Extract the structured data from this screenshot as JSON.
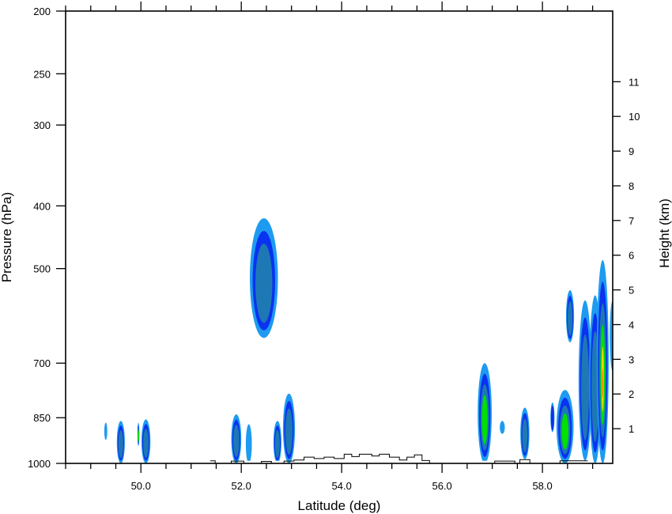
{
  "chart_data": {
    "type": "contour",
    "title": "",
    "xlabel": "Latitude (deg)",
    "ylabel": "Pressure (hPa)",
    "y2label": "Height (km)",
    "xlim": [
      48.5,
      59.4
    ],
    "ylim_pressure": [
      1000,
      200
    ],
    "y_scale": "log",
    "x_ticks": [
      {
        "value": 50.0,
        "label": "50.0"
      },
      {
        "value": 52.0,
        "label": "52.0"
      },
      {
        "value": 54.0,
        "label": "54.0"
      },
      {
        "value": 56.0,
        "label": "56.0"
      },
      {
        "value": 58.0,
        "label": "58.0"
      }
    ],
    "x_minor_ticks": [
      48.5,
      49.0,
      49.5,
      50.5,
      51.0,
      51.5,
      52.5,
      53.0,
      53.5,
      54.5,
      55.0,
      55.5,
      56.5,
      57.0,
      57.5,
      58.5,
      59.0
    ],
    "y_ticks": [
      {
        "value": 200,
        "label": "200"
      },
      {
        "value": 250,
        "label": "250"
      },
      {
        "value": 300,
        "label": "300"
      },
      {
        "value": 400,
        "label": "400"
      },
      {
        "value": 500,
        "label": "500"
      },
      {
        "value": 700,
        "label": "700"
      },
      {
        "value": 850,
        "label": "850"
      },
      {
        "value": 1000,
        "label": "1000"
      }
    ],
    "y2_ticks": [
      {
        "value": 1,
        "label": "1"
      },
      {
        "value": 2,
        "label": "2"
      },
      {
        "value": 3,
        "label": "3"
      },
      {
        "value": 4,
        "label": "4"
      },
      {
        "value": 5,
        "label": "5"
      },
      {
        "value": 6,
        "label": "6"
      },
      {
        "value": 7,
        "label": "7"
      },
      {
        "value": 8,
        "label": "8"
      },
      {
        "value": 9,
        "label": "9"
      },
      {
        "value": 10,
        "label": "10"
      },
      {
        "value": 11,
        "label": "11"
      }
    ],
    "fill_levels": [
      {
        "level": 1,
        "color": "#1E9BF0"
      },
      {
        "level": 2,
        "color": "#0A32F0"
      },
      {
        "level": 3,
        "color": "#1E78B4"
      },
      {
        "level": 4,
        "color": "#00E100"
      },
      {
        "level": 5,
        "color": "#F0DC00"
      },
      {
        "level": 6,
        "color": "#FF8C00"
      }
    ],
    "cells": [
      {
        "lat": 49.3,
        "p_top": 865,
        "p_bot": 920,
        "half_width": 0.03,
        "max_level": 1
      },
      {
        "lat": 49.6,
        "p_top": 860,
        "p_bot": 1000,
        "half_width": 0.08,
        "max_level": 3
      },
      {
        "lat": 49.95,
        "p_top": 865,
        "p_bot": 940,
        "half_width": 0.02,
        "max_level": 4
      },
      {
        "lat": 50.1,
        "p_top": 855,
        "p_bot": 1000,
        "half_width": 0.09,
        "max_level": 3
      },
      {
        "lat": 51.9,
        "p_top": 840,
        "p_bot": 1000,
        "half_width": 0.1,
        "max_level": 3
      },
      {
        "lat": 52.15,
        "p_top": 870,
        "p_bot": 1000,
        "half_width": 0.06,
        "max_level": 1
      },
      {
        "lat": 52.45,
        "p_top": 418,
        "p_bot": 640,
        "half_width": 0.28,
        "max_level": 3
      },
      {
        "lat": 52.72,
        "p_top": 860,
        "p_bot": 1000,
        "half_width": 0.08,
        "max_level": 3
      },
      {
        "lat": 52.95,
        "p_top": 780,
        "p_bot": 1000,
        "half_width": 0.12,
        "max_level": 3
      },
      {
        "lat": 56.85,
        "p_top": 700,
        "p_bot": 1000,
        "half_width": 0.14,
        "max_level": 4
      },
      {
        "lat": 57.2,
        "p_top": 860,
        "p_bot": 900,
        "half_width": 0.05,
        "max_level": 1
      },
      {
        "lat": 57.65,
        "p_top": 820,
        "p_bot": 985,
        "half_width": 0.09,
        "max_level": 3
      },
      {
        "lat": 58.2,
        "p_top": 805,
        "p_bot": 895,
        "half_width": 0.04,
        "max_level": 2
      },
      {
        "lat": 58.45,
        "p_top": 770,
        "p_bot": 1000,
        "half_width": 0.17,
        "max_level": 4
      },
      {
        "lat": 58.55,
        "p_top": 540,
        "p_bot": 650,
        "half_width": 0.08,
        "max_level": 3
      },
      {
        "lat": 58.85,
        "p_top": 560,
        "p_bot": 990,
        "half_width": 0.13,
        "max_level": 3
      },
      {
        "lat": 59.05,
        "p_top": 550,
        "p_bot": 1000,
        "half_width": 0.12,
        "max_level": 3
      },
      {
        "lat": 59.2,
        "p_top": 485,
        "p_bot": 1000,
        "half_width": 0.12,
        "max_level": 6
      },
      {
        "lat": 59.4,
        "p_top": 560,
        "p_bot": 720,
        "half_width": 0.06,
        "max_level": 1
      }
    ],
    "terrain": [
      [
        51.38,
        991
      ],
      [
        51.48,
        991
      ],
      [
        51.48,
        1000
      ],
      [
        51.8,
        1000
      ],
      [
        51.8,
        992
      ],
      [
        52.05,
        992
      ],
      [
        52.05,
        1000
      ],
      [
        52.4,
        1000
      ],
      [
        52.4,
        993
      ],
      [
        52.6,
        993
      ],
      [
        52.6,
        1000
      ],
      [
        52.85,
        1000
      ],
      [
        52.85,
        992
      ],
      [
        53.05,
        992
      ],
      [
        53.05,
        988
      ],
      [
        53.25,
        988
      ],
      [
        53.25,
        978
      ],
      [
        53.45,
        978
      ],
      [
        53.45,
        983
      ],
      [
        53.65,
        983
      ],
      [
        53.65,
        978
      ],
      [
        53.85,
        978
      ],
      [
        53.85,
        983
      ],
      [
        54.05,
        983
      ],
      [
        54.05,
        968
      ],
      [
        54.2,
        968
      ],
      [
        54.2,
        976
      ],
      [
        54.35,
        976
      ],
      [
        54.35,
        968
      ],
      [
        54.6,
        968
      ],
      [
        54.6,
        974
      ],
      [
        54.75,
        974
      ],
      [
        54.75,
        968
      ],
      [
        54.95,
        968
      ],
      [
        54.95,
        978
      ],
      [
        55.15,
        978
      ],
      [
        55.15,
        988
      ],
      [
        55.3,
        988
      ],
      [
        55.3,
        978
      ],
      [
        55.45,
        978
      ],
      [
        55.45,
        970
      ],
      [
        55.6,
        970
      ],
      [
        55.6,
        990
      ],
      [
        55.75,
        990
      ],
      [
        55.75,
        1000
      ],
      [
        57.05,
        1000
      ],
      [
        57.05,
        992
      ],
      [
        57.45,
        992
      ],
      [
        57.45,
        1000
      ],
      [
        57.55,
        1000
      ],
      [
        57.55,
        987
      ],
      [
        57.75,
        987
      ],
      [
        57.75,
        1000
      ],
      [
        58.35,
        1000
      ],
      [
        58.35,
        991
      ],
      [
        58.9,
        991
      ]
    ]
  }
}
